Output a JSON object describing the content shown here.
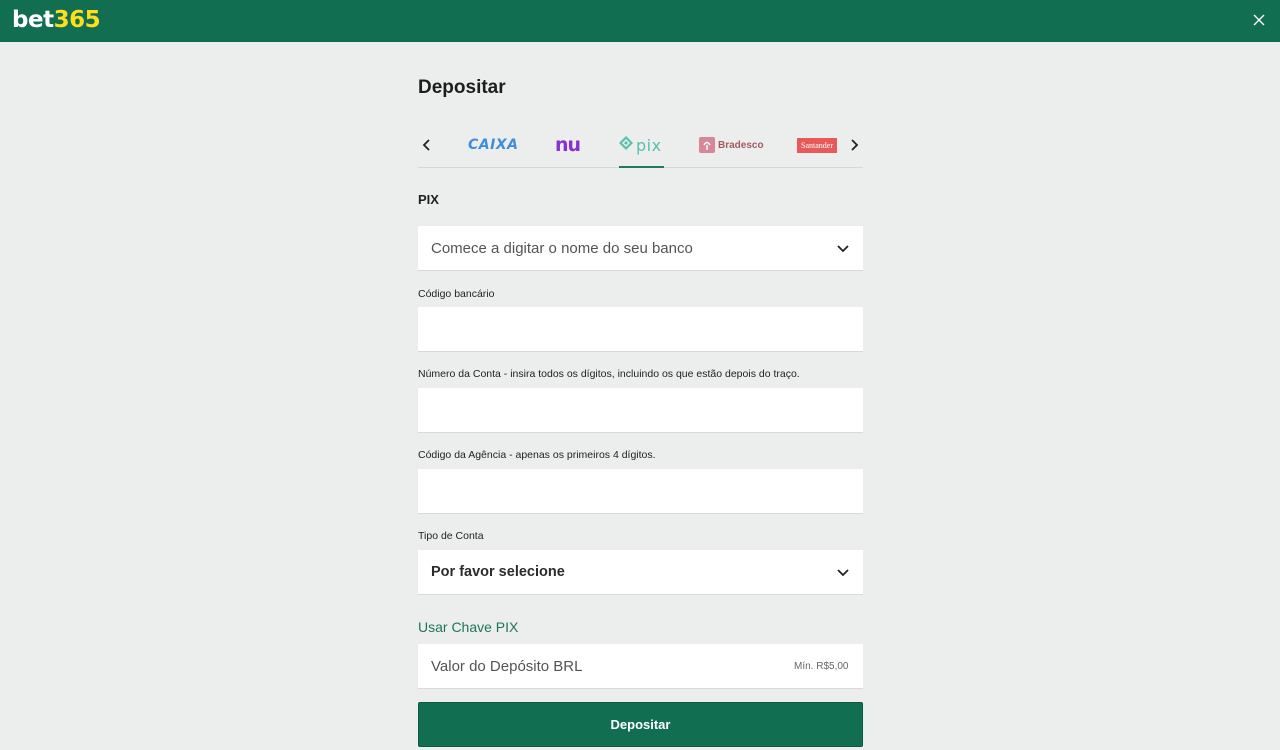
{
  "header": {
    "logo_part1": "bet",
    "logo_part2": "365",
    "close_icon": "close-icon",
    "background_color": "#126e51",
    "logo_accent_color": "#ffdf1b"
  },
  "page": {
    "title": "Depositar"
  },
  "banks": {
    "prev_icon": "chevron-left-icon",
    "next_icon": "chevron-right-icon",
    "items": [
      {
        "label": "CAIXA",
        "selected": false
      },
      {
        "label": "nu",
        "selected": false
      },
      {
        "label": "pix",
        "selected": true
      },
      {
        "label": "Bradesco",
        "selected": false
      },
      {
        "label": "Santander",
        "selected": false
      }
    ]
  },
  "form": {
    "section_title": "PIX",
    "bank_select": {
      "placeholder": "Comece a digitar o nome do seu banco"
    },
    "bank_code": {
      "label": "Código bancário",
      "value": ""
    },
    "account_number": {
      "label": "Número da Conta - insira todos os dígitos, incluindo os que estão depois do traço.",
      "value": ""
    },
    "agency_code": {
      "label": "Código da Agência - apenas os primeiros 4 dígitos.",
      "value": ""
    },
    "account_type": {
      "label": "Tipo de Conta",
      "selected": "Por favor selecione"
    },
    "pix_key_link": "Usar Chave PIX",
    "deposit_amount": {
      "placeholder": "Valor do Depósito BRL",
      "min_hint": "Mín. R$5,00"
    },
    "submit_label": "Depositar"
  },
  "colors": {
    "accent": "#126e51",
    "link": "#1e7657",
    "background": "#eceeed"
  }
}
